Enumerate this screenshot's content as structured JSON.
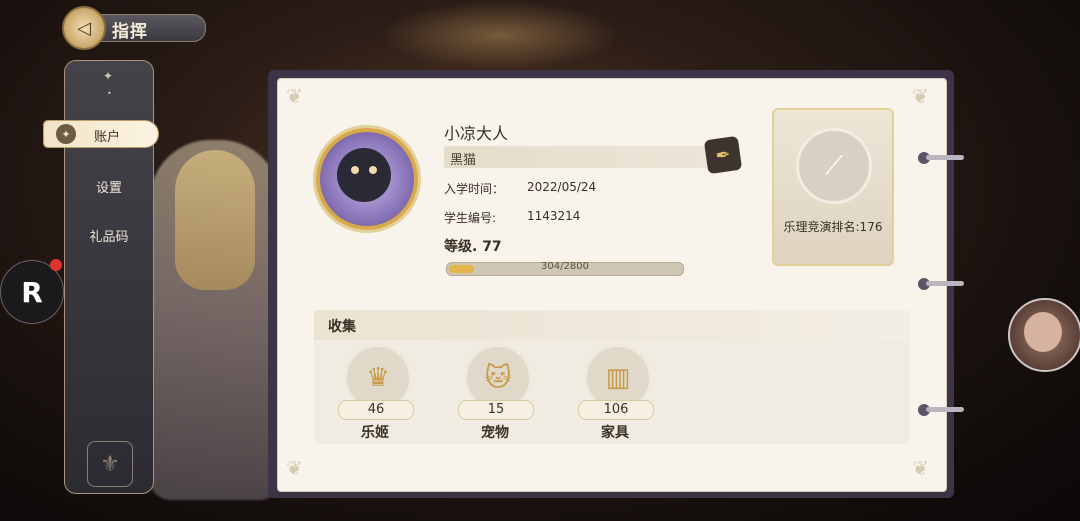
{
  "header": {
    "title": "指挥"
  },
  "sidebar": {
    "items": [
      {
        "label": "账户",
        "active": true
      },
      {
        "label": "设置",
        "active": false
      },
      {
        "label": "礼品码",
        "active": false
      }
    ]
  },
  "profile": {
    "name": "小凉大人",
    "title_badge": "黑猫",
    "enroll_label": "入学时间：",
    "enroll_value": "2022/05/24",
    "student_id_label": "学生编号:",
    "student_id_value": "1143214",
    "level_label": "等级. 77",
    "xp_text": "304/2800",
    "xp_current": 304,
    "xp_max": 2800
  },
  "rank": {
    "label": "乐理竞演排名:176"
  },
  "collection": {
    "title": "收集",
    "items": [
      {
        "count": "46",
        "label": "乐姬",
        "icon": "girl-silhouette-icon"
      },
      {
        "count": "15",
        "label": "宠物",
        "icon": "cat-icon"
      },
      {
        "count": "106",
        "label": "家具",
        "icon": "bookshelf-icon"
      }
    ]
  },
  "colors": {
    "accent": "#e4b548",
    "panel": "#f8f4ec",
    "sidebar": "#3b393f"
  }
}
